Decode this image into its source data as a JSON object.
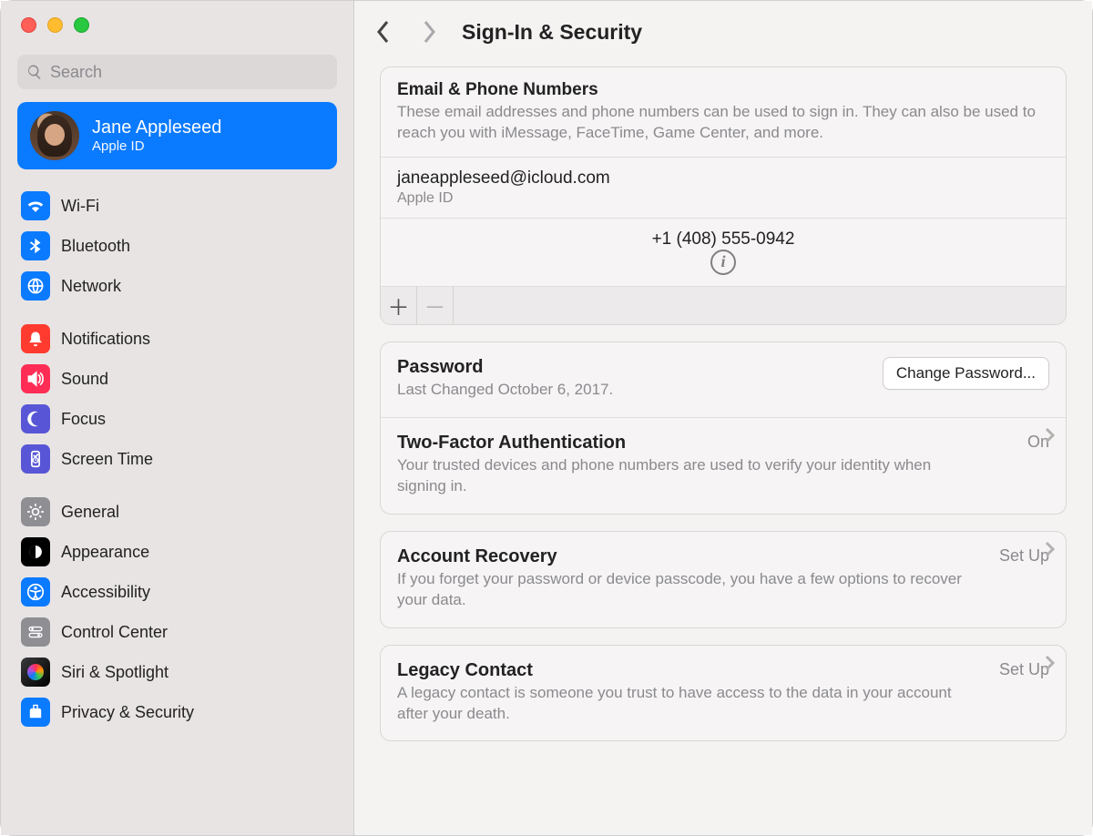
{
  "search": {
    "placeholder": "Search"
  },
  "account": {
    "name": "Jane Appleseed",
    "subtitle": "Apple ID"
  },
  "sidebar_groups": [
    {
      "items": [
        {
          "id": "wifi",
          "label": "Wi-Fi",
          "bg": "#0a7aff"
        },
        {
          "id": "bluetooth",
          "label": "Bluetooth",
          "bg": "#0a7aff"
        },
        {
          "id": "network",
          "label": "Network",
          "bg": "#0a7aff"
        }
      ]
    },
    {
      "items": [
        {
          "id": "notifications",
          "label": "Notifications",
          "bg": "#ff3b30"
        },
        {
          "id": "sound",
          "label": "Sound",
          "bg": "#ff2d55"
        },
        {
          "id": "focus",
          "label": "Focus",
          "bg": "#5856d6"
        },
        {
          "id": "screentime",
          "label": "Screen Time",
          "bg": "#5856d6"
        }
      ]
    },
    {
      "items": [
        {
          "id": "general",
          "label": "General",
          "bg": "#8e8e93"
        },
        {
          "id": "appearance",
          "label": "Appearance",
          "bg": "#000000"
        },
        {
          "id": "accessibility",
          "label": "Accessibility",
          "bg": "#0a7aff"
        },
        {
          "id": "controlcenter",
          "label": "Control Center",
          "bg": "#8e8e93"
        },
        {
          "id": "siri",
          "label": "Siri & Spotlight",
          "bg": "#1c1c1e"
        },
        {
          "id": "privacy",
          "label": "Privacy & Security",
          "bg": "#0a7aff"
        }
      ]
    }
  ],
  "header": {
    "title": "Sign-In & Security"
  },
  "email_section": {
    "title": "Email & Phone Numbers",
    "description": "These email addresses and phone numbers can be used to sign in. They can also be used to reach you with iMessage, FaceTime, Game Center, and more.",
    "rows": [
      {
        "primary": "janeappleseed@icloud.com",
        "secondary": "Apple ID"
      },
      {
        "primary": "+1 (408) 555-0942"
      }
    ]
  },
  "password_section": {
    "title": "Password",
    "subtitle": "Last Changed October 6, 2017.",
    "button": "Change Password..."
  },
  "twofa_section": {
    "title": "Two-Factor Authentication",
    "status": "On",
    "description": "Your trusted devices and phone numbers are used to verify your identity when signing in."
  },
  "recovery_section": {
    "title": "Account Recovery",
    "status": "Set Up",
    "description": "If you forget your password or device passcode, you have a few options to recover your data."
  },
  "legacy_section": {
    "title": "Legacy Contact",
    "status": "Set Up",
    "description": "A legacy contact is someone you trust to have access to the data in your account after your death."
  }
}
